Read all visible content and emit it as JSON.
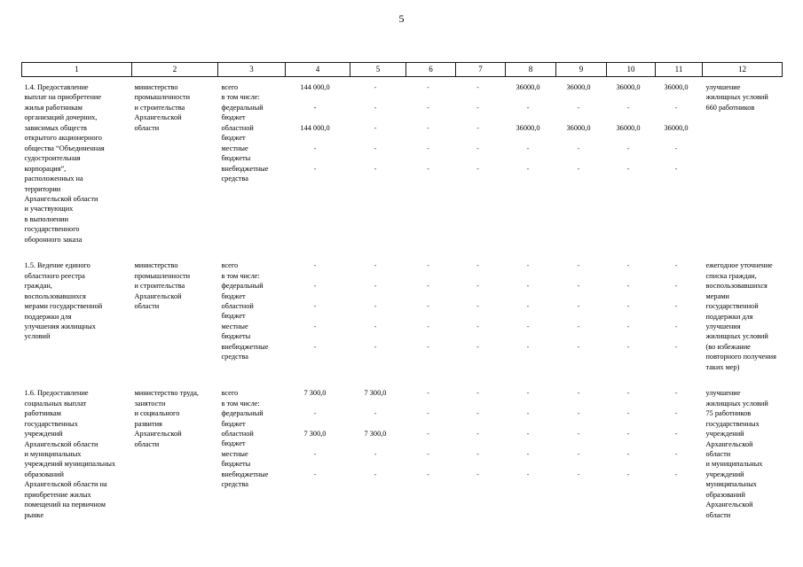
{
  "page": {
    "number": "5"
  },
  "table": {
    "column_headers": [
      "1",
      "2",
      "3",
      "4",
      "5",
      "6",
      "7",
      "8",
      "9",
      "10",
      "11",
      "12"
    ],
    "budget_labels": {
      "total": "всего",
      "including": "в том числе:",
      "federal": "федеральный\nбюджет",
      "regional": "областной\nбюджет",
      "local": "местные\nбюджеты",
      "extrabudget": "внебюджетные\nсредства"
    },
    "rows": [
      {
        "id": "row-1-4",
        "measure": "1.4. Предоставление\nвыплат на приобретение\nжилья работникам\nорганизаций дочерних,\nзависимых обществ\nоткрытого акционерного\nобщества “Объединенная\nсудостроительная\nкорпорация”,\nрасположенных на\nтерритории\nАрхангельской области\nи участвующих\nв выполнении\nгосударственного\nоборонного заказа",
        "executor": "министерство\nпромышленности\nи строительства\nАрхангельской\nобласти",
        "result": "улучшение\nжилищных условий\n660 работников",
        "lines": [
          {
            "label": "total",
            "values": [
              "144 000,0",
              "-",
              "-",
              "-",
              "36000,0",
              "36000,0",
              "36000,0",
              "36000,0"
            ]
          },
          {
            "label": "including",
            "values": [
              "",
              "",
              "",
              "",
              "",
              "",
              "",
              ""
            ]
          },
          {
            "label": "federal",
            "values": [
              "-",
              "-",
              "-",
              "-",
              "-",
              "-",
              "-",
              "-"
            ]
          },
          {
            "label": "regional",
            "values": [
              "144 000,0",
              "-",
              "-",
              "-",
              "36000,0",
              "36000,0",
              "36000,0",
              "36000,0"
            ]
          },
          {
            "label": "local",
            "values": [
              "-",
              "-",
              "-",
              "-",
              "-",
              "-",
              "-",
              "-"
            ]
          },
          {
            "label": "extrabudget",
            "values": [
              "-",
              "-",
              "-",
              "-",
              "-",
              "-",
              "-",
              "-"
            ]
          }
        ]
      },
      {
        "id": "row-1-5",
        "measure": "1.5. Ведение единого\nобластного реестра\nграждан,\nвоспользовавшихся\nмерами государственной\nподдержки для\nулучшения жилищных\nусловий",
        "executor": "министерство\nпромышленности\nи строительства\nАрхангельской\nобласти",
        "result": "ежегодное уточнение\nсписка граждан,\nвоспользовавшихся\nмерами\nгосударственной\nподдержки для\nулучшения\nжилищных условий\n(во избежание\nповторного получения\nтаких мер)",
        "lines": [
          {
            "label": "total",
            "values": [
              "-",
              "-",
              "-",
              "-",
              "-",
              "-",
              "-",
              "-"
            ]
          },
          {
            "label": "including",
            "values": [
              "",
              "",
              "",
              "",
              "",
              "",
              "",
              ""
            ]
          },
          {
            "label": "federal",
            "values": [
              "-",
              "-",
              "-",
              "-",
              "-",
              "-",
              "-",
              "-"
            ]
          },
          {
            "label": "regional",
            "values": [
              "-",
              "-",
              "-",
              "-",
              "-",
              "-",
              "-",
              "-"
            ]
          },
          {
            "label": "local",
            "values": [
              "-",
              "-",
              "-",
              "-",
              "-",
              "-",
              "-",
              "-"
            ]
          },
          {
            "label": "extrabudget",
            "values": [
              "-",
              "-",
              "-",
              "-",
              "-",
              "-",
              "-",
              "-"
            ]
          }
        ]
      },
      {
        "id": "row-1-6",
        "measure": "1.6. Предоставление\nсоциальных выплат\nработникам\nгосударственных\nучреждений\nАрхангельской области\nи муниципальных\nучреждений муниципальных\nобразований\nАрхангельской области на\nприобретение жилых\nпомещений на первичном\nрынке",
        "executor": "министерство труда,\nзанятости\nи социального\nразвития\nАрхангельской\nобласти",
        "result": "улучшение\nжилищных условий\n75 работников\nгосударственных\nучреждений\nАрхангельской\nобласти\nи муниципальных\nучреждений\nмуниципальных\nобразований\nАрхангельской\nобласти",
        "lines": [
          {
            "label": "total",
            "values": [
              "7 300,0",
              "7 300,0",
              "-",
              "-",
              "-",
              "-",
              "-",
              "-"
            ]
          },
          {
            "label": "including",
            "values": [
              "",
              "",
              "",
              "",
              "",
              "",
              "",
              ""
            ]
          },
          {
            "label": "federal",
            "values": [
              "-",
              "-",
              "-",
              "-",
              "-",
              "-",
              "-",
              "-"
            ]
          },
          {
            "label": "regional",
            "values": [
              "7 300,0",
              "7 300,0",
              "-",
              "-",
              "-",
              "-",
              "-",
              "-"
            ]
          },
          {
            "label": "local",
            "values": [
              "-",
              "-",
              "-",
              "-",
              "-",
              "-",
              "-",
              "-"
            ]
          },
          {
            "label": "extrabudget",
            "values": [
              "-",
              "-",
              "-",
              "-",
              "-",
              "-",
              "-",
              "-"
            ]
          }
        ]
      }
    ]
  }
}
